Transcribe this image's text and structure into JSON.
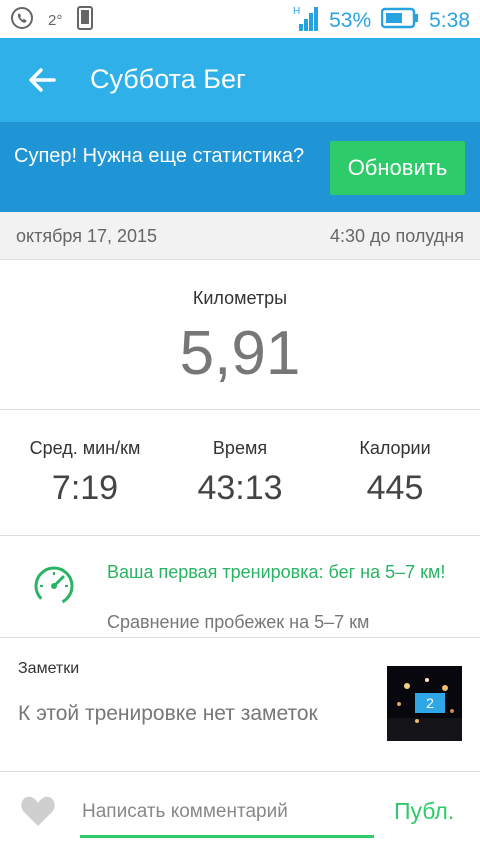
{
  "status_bar": {
    "temperature": "2°",
    "battery_percent": "53%",
    "clock": "5:38",
    "signal_type": "H",
    "icons": [
      "viber-icon",
      "phone-icon",
      "signal-icon",
      "battery-icon"
    ]
  },
  "header": {
    "title": "Суббота Бег",
    "back_icon": "arrow-left-icon"
  },
  "promo": {
    "text": "Супер! Нужна еще статистика?",
    "button_label": "Обновить"
  },
  "datebar": {
    "date": "октября 17, 2015",
    "time": "4:30 до полудня"
  },
  "distance": {
    "label": "Километры",
    "value": "5,91"
  },
  "stats": [
    {
      "label": "Сред. мин/км",
      "value": "7:19"
    },
    {
      "label": "Время",
      "value": "43:13"
    },
    {
      "label": "Калории",
      "value": "445"
    }
  ],
  "achievement": {
    "icon": "speedometer-icon",
    "headline": "Ваша первая тренировка: бег на 5–7 км!",
    "subtext": "Сравнение пробежек на 5–7 км"
  },
  "notes": {
    "title": "Заметки",
    "body": "К этой тренировке нет заметок",
    "photo_count": "2"
  },
  "comment": {
    "placeholder": "Написать комментарий",
    "post_label": "Публ.",
    "like_icon": "heart-icon"
  },
  "colors": {
    "status_blue": "#29a3e0",
    "appbar_blue": "#2fb0e8",
    "promo_blue": "#1f95d6",
    "accent_green": "#2ecb6a"
  }
}
